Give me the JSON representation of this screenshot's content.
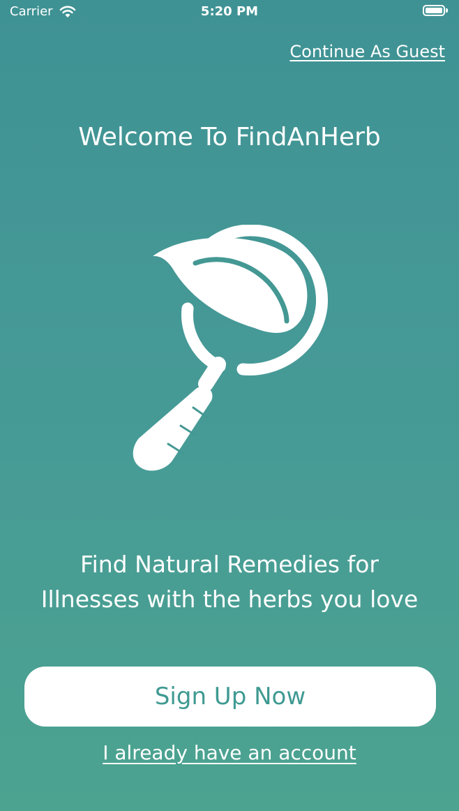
{
  "status_bar": {
    "carrier": "Carrier",
    "time": "5:20 PM",
    "wifi_icon": "wifi-icon",
    "battery_icon": "battery-icon"
  },
  "header": {
    "guest_link": "Continue As Guest"
  },
  "main": {
    "welcome": "Welcome To FindAnHerb",
    "logo_icon": "leaf-magnifier-icon",
    "tagline_line1": "Find Natural Remedies for",
    "tagline_line2": "Illnesses with the herbs you love"
  },
  "actions": {
    "signup_label": "Sign Up Now",
    "account_link": "I already have an account"
  },
  "colors": {
    "background_top": "#3f9294",
    "background_bottom": "#4ca38f",
    "button_text": "#3f9a92"
  }
}
